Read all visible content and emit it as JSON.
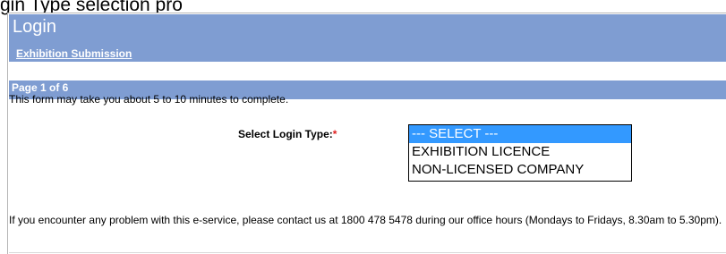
{
  "caption": "gin Type selection pro",
  "header": {
    "title": "Login",
    "link_label": "Exhibition Submission"
  },
  "page_bar": {
    "label": "Page 1 of 6"
  },
  "form": {
    "intro": "This form may take you about 5 to 10 minutes to complete.",
    "login_type": {
      "label": "Select Login Type:",
      "required_marker": "*",
      "options": [
        {
          "label": "--- SELECT ---",
          "selected": true
        },
        {
          "label": "EXHIBITION LICENCE",
          "selected": false
        },
        {
          "label": "NON-LICENSED COMPANY",
          "selected": false
        }
      ]
    }
  },
  "footer": {
    "contact_text": "If you encounter any problem with this e-service, please contact us at 1800 478 5478 during our office hours (Mondays to Fridays, 8.30am to 5.30pm)."
  },
  "colors": {
    "header_bg": "#7f9dd2",
    "selected_option_bg": "#3399ff",
    "required_marker": "#e02020"
  }
}
